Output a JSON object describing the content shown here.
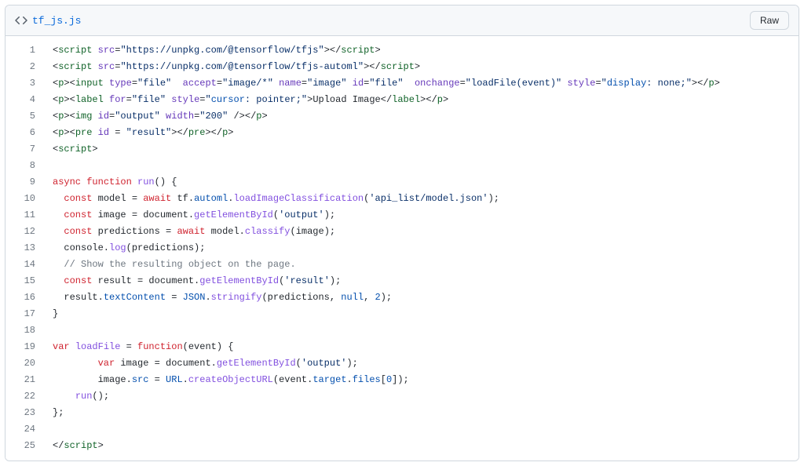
{
  "file": {
    "name": "tf_js.js",
    "raw_label": "Raw"
  },
  "code": {
    "line_count": 25,
    "lines": [
      {
        "n": 1,
        "tokens": [
          {
            "t": "<",
            "c": "plain"
          },
          {
            "t": "script",
            "c": "pl-ent"
          },
          {
            "t": " ",
            "c": "plain"
          },
          {
            "t": "src",
            "c": "pl-e"
          },
          {
            "t": "=",
            "c": "plain"
          },
          {
            "t": "\"https://unpkg.com/@tensorflow/tfjs\"",
            "c": "pl-s"
          },
          {
            "t": ">",
            "c": "plain"
          },
          {
            "t": "</",
            "c": "plain"
          },
          {
            "t": "script",
            "c": "pl-ent"
          },
          {
            "t": ">",
            "c": "plain"
          }
        ]
      },
      {
        "n": 2,
        "tokens": [
          {
            "t": "<",
            "c": "plain"
          },
          {
            "t": "script",
            "c": "pl-ent"
          },
          {
            "t": " ",
            "c": "plain"
          },
          {
            "t": "src",
            "c": "pl-e"
          },
          {
            "t": "=",
            "c": "plain"
          },
          {
            "t": "\"https://unpkg.com/@tensorflow/tfjs-automl\"",
            "c": "pl-s"
          },
          {
            "t": ">",
            "c": "plain"
          },
          {
            "t": "</",
            "c": "plain"
          },
          {
            "t": "script",
            "c": "pl-ent"
          },
          {
            "t": ">",
            "c": "plain"
          }
        ]
      },
      {
        "n": 3,
        "tokens": [
          {
            "t": "<",
            "c": "plain"
          },
          {
            "t": "p",
            "c": "pl-ent"
          },
          {
            "t": ">",
            "c": "plain"
          },
          {
            "t": "<",
            "c": "plain"
          },
          {
            "t": "input",
            "c": "pl-ent"
          },
          {
            "t": " ",
            "c": "plain"
          },
          {
            "t": "type",
            "c": "pl-e"
          },
          {
            "t": "=",
            "c": "plain"
          },
          {
            "t": "\"file\"",
            "c": "pl-s"
          },
          {
            "t": "  ",
            "c": "plain"
          },
          {
            "t": "accept",
            "c": "pl-e"
          },
          {
            "t": "=",
            "c": "plain"
          },
          {
            "t": "\"image/*\"",
            "c": "pl-s"
          },
          {
            "t": " ",
            "c": "plain"
          },
          {
            "t": "name",
            "c": "pl-e"
          },
          {
            "t": "=",
            "c": "plain"
          },
          {
            "t": "\"image\"",
            "c": "pl-s"
          },
          {
            "t": " ",
            "c": "plain"
          },
          {
            "t": "id",
            "c": "pl-e"
          },
          {
            "t": "=",
            "c": "plain"
          },
          {
            "t": "\"file\"",
            "c": "pl-s"
          },
          {
            "t": "  ",
            "c": "plain"
          },
          {
            "t": "onchange",
            "c": "pl-e"
          },
          {
            "t": "=",
            "c": "plain"
          },
          {
            "t": "\"",
            "c": "pl-s"
          },
          {
            "t": "loadFile(event)",
            "c": "pl-s"
          },
          {
            "t": "\"",
            "c": "pl-s"
          },
          {
            "t": " ",
            "c": "plain"
          },
          {
            "t": "style",
            "c": "pl-e"
          },
          {
            "t": "=",
            "c": "plain"
          },
          {
            "t": "\"",
            "c": "pl-s"
          },
          {
            "t": "display",
            "c": "pl-c1"
          },
          {
            "t": ": none;",
            "c": "pl-s"
          },
          {
            "t": "\"",
            "c": "pl-s"
          },
          {
            "t": ">",
            "c": "plain"
          },
          {
            "t": "</",
            "c": "plain"
          },
          {
            "t": "p",
            "c": "pl-ent"
          },
          {
            "t": ">",
            "c": "plain"
          }
        ]
      },
      {
        "n": 4,
        "tokens": [
          {
            "t": "<",
            "c": "plain"
          },
          {
            "t": "p",
            "c": "pl-ent"
          },
          {
            "t": ">",
            "c": "plain"
          },
          {
            "t": "<",
            "c": "plain"
          },
          {
            "t": "label",
            "c": "pl-ent"
          },
          {
            "t": " ",
            "c": "plain"
          },
          {
            "t": "for",
            "c": "pl-e"
          },
          {
            "t": "=",
            "c": "plain"
          },
          {
            "t": "\"file\"",
            "c": "pl-s"
          },
          {
            "t": " ",
            "c": "plain"
          },
          {
            "t": "style",
            "c": "pl-e"
          },
          {
            "t": "=",
            "c": "plain"
          },
          {
            "t": "\"",
            "c": "pl-s"
          },
          {
            "t": "cursor",
            "c": "pl-c1"
          },
          {
            "t": ": pointer;",
            "c": "pl-s"
          },
          {
            "t": "\"",
            "c": "pl-s"
          },
          {
            "t": ">Upload Image</",
            "c": "plain"
          },
          {
            "t": "label",
            "c": "pl-ent"
          },
          {
            "t": ">",
            "c": "plain"
          },
          {
            "t": "</",
            "c": "plain"
          },
          {
            "t": "p",
            "c": "pl-ent"
          },
          {
            "t": ">",
            "c": "plain"
          }
        ]
      },
      {
        "n": 5,
        "tokens": [
          {
            "t": "<",
            "c": "plain"
          },
          {
            "t": "p",
            "c": "pl-ent"
          },
          {
            "t": ">",
            "c": "plain"
          },
          {
            "t": "<",
            "c": "plain"
          },
          {
            "t": "img",
            "c": "pl-ent"
          },
          {
            "t": " ",
            "c": "plain"
          },
          {
            "t": "id",
            "c": "pl-e"
          },
          {
            "t": "=",
            "c": "plain"
          },
          {
            "t": "\"output\"",
            "c": "pl-s"
          },
          {
            "t": " ",
            "c": "plain"
          },
          {
            "t": "width",
            "c": "pl-e"
          },
          {
            "t": "=",
            "c": "plain"
          },
          {
            "t": "\"200\"",
            "c": "pl-s"
          },
          {
            "t": " />",
            "c": "plain"
          },
          {
            "t": "</",
            "c": "plain"
          },
          {
            "t": "p",
            "c": "pl-ent"
          },
          {
            "t": ">",
            "c": "plain"
          }
        ]
      },
      {
        "n": 6,
        "tokens": [
          {
            "t": "<",
            "c": "plain"
          },
          {
            "t": "p",
            "c": "pl-ent"
          },
          {
            "t": ">",
            "c": "plain"
          },
          {
            "t": "<",
            "c": "plain"
          },
          {
            "t": "pre",
            "c": "pl-ent"
          },
          {
            "t": " ",
            "c": "plain"
          },
          {
            "t": "id",
            "c": "pl-e"
          },
          {
            "t": " = ",
            "c": "plain"
          },
          {
            "t": "\"result\"",
            "c": "pl-s"
          },
          {
            "t": ">",
            "c": "plain"
          },
          {
            "t": "</",
            "c": "plain"
          },
          {
            "t": "pre",
            "c": "pl-ent"
          },
          {
            "t": ">",
            "c": "plain"
          },
          {
            "t": "</",
            "c": "plain"
          },
          {
            "t": "p",
            "c": "pl-ent"
          },
          {
            "t": ">",
            "c": "plain"
          }
        ]
      },
      {
        "n": 7,
        "tokens": [
          {
            "t": "<",
            "c": "plain"
          },
          {
            "t": "script",
            "c": "pl-ent"
          },
          {
            "t": ">",
            "c": "plain"
          }
        ]
      },
      {
        "n": 8,
        "tokens": [
          {
            "t": "",
            "c": "plain"
          }
        ]
      },
      {
        "n": 9,
        "tokens": [
          {
            "t": "async",
            "c": "pl-k"
          },
          {
            "t": " ",
            "c": "plain"
          },
          {
            "t": "function",
            "c": "pl-k"
          },
          {
            "t": " ",
            "c": "plain"
          },
          {
            "t": "run",
            "c": "pl-en"
          },
          {
            "t": "() {",
            "c": "plain"
          }
        ]
      },
      {
        "n": 10,
        "tokens": [
          {
            "t": "  ",
            "c": "plain"
          },
          {
            "t": "const",
            "c": "pl-k"
          },
          {
            "t": " model = ",
            "c": "plain"
          },
          {
            "t": "await",
            "c": "pl-k"
          },
          {
            "t": " tf.",
            "c": "plain"
          },
          {
            "t": "automl",
            "c": "pl-c1"
          },
          {
            "t": ".",
            "c": "plain"
          },
          {
            "t": "loadImageClassification",
            "c": "pl-en"
          },
          {
            "t": "(",
            "c": "plain"
          },
          {
            "t": "'api_list/model.json'",
            "c": "pl-s"
          },
          {
            "t": ");",
            "c": "plain"
          }
        ]
      },
      {
        "n": 11,
        "tokens": [
          {
            "t": "  ",
            "c": "plain"
          },
          {
            "t": "const",
            "c": "pl-k"
          },
          {
            "t": " image = document.",
            "c": "plain"
          },
          {
            "t": "getElementById",
            "c": "pl-en"
          },
          {
            "t": "(",
            "c": "plain"
          },
          {
            "t": "'output'",
            "c": "pl-s"
          },
          {
            "t": ");",
            "c": "plain"
          }
        ]
      },
      {
        "n": 12,
        "tokens": [
          {
            "t": "  ",
            "c": "plain"
          },
          {
            "t": "const",
            "c": "pl-k"
          },
          {
            "t": " predictions = ",
            "c": "plain"
          },
          {
            "t": "await",
            "c": "pl-k"
          },
          {
            "t": " model.",
            "c": "plain"
          },
          {
            "t": "classify",
            "c": "pl-en"
          },
          {
            "t": "(image);",
            "c": "plain"
          }
        ]
      },
      {
        "n": 13,
        "tokens": [
          {
            "t": "  console.",
            "c": "plain"
          },
          {
            "t": "log",
            "c": "pl-en"
          },
          {
            "t": "(predictions);",
            "c": "plain"
          }
        ]
      },
      {
        "n": 14,
        "tokens": [
          {
            "t": "  ",
            "c": "plain"
          },
          {
            "t": "// Show the resulting object on the page.",
            "c": "pl-c"
          }
        ]
      },
      {
        "n": 15,
        "tokens": [
          {
            "t": "  ",
            "c": "plain"
          },
          {
            "t": "const",
            "c": "pl-k"
          },
          {
            "t": " result = document.",
            "c": "plain"
          },
          {
            "t": "getElementById",
            "c": "pl-en"
          },
          {
            "t": "(",
            "c": "plain"
          },
          {
            "t": "'result'",
            "c": "pl-s"
          },
          {
            "t": ");",
            "c": "plain"
          }
        ]
      },
      {
        "n": 16,
        "tokens": [
          {
            "t": "  result.",
            "c": "plain"
          },
          {
            "t": "textContent",
            "c": "pl-c1"
          },
          {
            "t": " = ",
            "c": "plain"
          },
          {
            "t": "JSON",
            "c": "pl-c1"
          },
          {
            "t": ".",
            "c": "plain"
          },
          {
            "t": "stringify",
            "c": "pl-en"
          },
          {
            "t": "(predictions, ",
            "c": "plain"
          },
          {
            "t": "null",
            "c": "pl-c1"
          },
          {
            "t": ", ",
            "c": "plain"
          },
          {
            "t": "2",
            "c": "pl-c1"
          },
          {
            "t": ");",
            "c": "plain"
          }
        ]
      },
      {
        "n": 17,
        "tokens": [
          {
            "t": "}",
            "c": "plain"
          }
        ]
      },
      {
        "n": 18,
        "tokens": [
          {
            "t": "",
            "c": "plain"
          }
        ]
      },
      {
        "n": 19,
        "tokens": [
          {
            "t": "var",
            "c": "pl-k"
          },
          {
            "t": " ",
            "c": "plain"
          },
          {
            "t": "loadFile",
            "c": "pl-en"
          },
          {
            "t": " = ",
            "c": "plain"
          },
          {
            "t": "function",
            "c": "pl-k"
          },
          {
            "t": "(event) {",
            "c": "plain"
          }
        ]
      },
      {
        "n": 20,
        "tokens": [
          {
            "t": "        ",
            "c": "plain"
          },
          {
            "t": "var",
            "c": "pl-k"
          },
          {
            "t": " image = document.",
            "c": "plain"
          },
          {
            "t": "getElementById",
            "c": "pl-en"
          },
          {
            "t": "(",
            "c": "plain"
          },
          {
            "t": "'output'",
            "c": "pl-s"
          },
          {
            "t": ");",
            "c": "plain"
          }
        ]
      },
      {
        "n": 21,
        "tokens": [
          {
            "t": "        image.",
            "c": "plain"
          },
          {
            "t": "src",
            "c": "pl-c1"
          },
          {
            "t": " = ",
            "c": "plain"
          },
          {
            "t": "URL",
            "c": "pl-c1"
          },
          {
            "t": ".",
            "c": "plain"
          },
          {
            "t": "createObjectURL",
            "c": "pl-en"
          },
          {
            "t": "(event.",
            "c": "plain"
          },
          {
            "t": "target",
            "c": "pl-c1"
          },
          {
            "t": ".",
            "c": "plain"
          },
          {
            "t": "files",
            "c": "pl-c1"
          },
          {
            "t": "[",
            "c": "plain"
          },
          {
            "t": "0",
            "c": "pl-c1"
          },
          {
            "t": "]);",
            "c": "plain"
          }
        ]
      },
      {
        "n": 22,
        "tokens": [
          {
            "t": "    ",
            "c": "plain"
          },
          {
            "t": "run",
            "c": "pl-en"
          },
          {
            "t": "();",
            "c": "plain"
          }
        ]
      },
      {
        "n": 23,
        "tokens": [
          {
            "t": "};",
            "c": "plain"
          }
        ]
      },
      {
        "n": 24,
        "tokens": [
          {
            "t": "",
            "c": "plain"
          }
        ]
      },
      {
        "n": 25,
        "tokens": [
          {
            "t": "</",
            "c": "plain"
          },
          {
            "t": "script",
            "c": "pl-ent"
          },
          {
            "t": ">",
            "c": "plain"
          }
        ]
      }
    ]
  }
}
